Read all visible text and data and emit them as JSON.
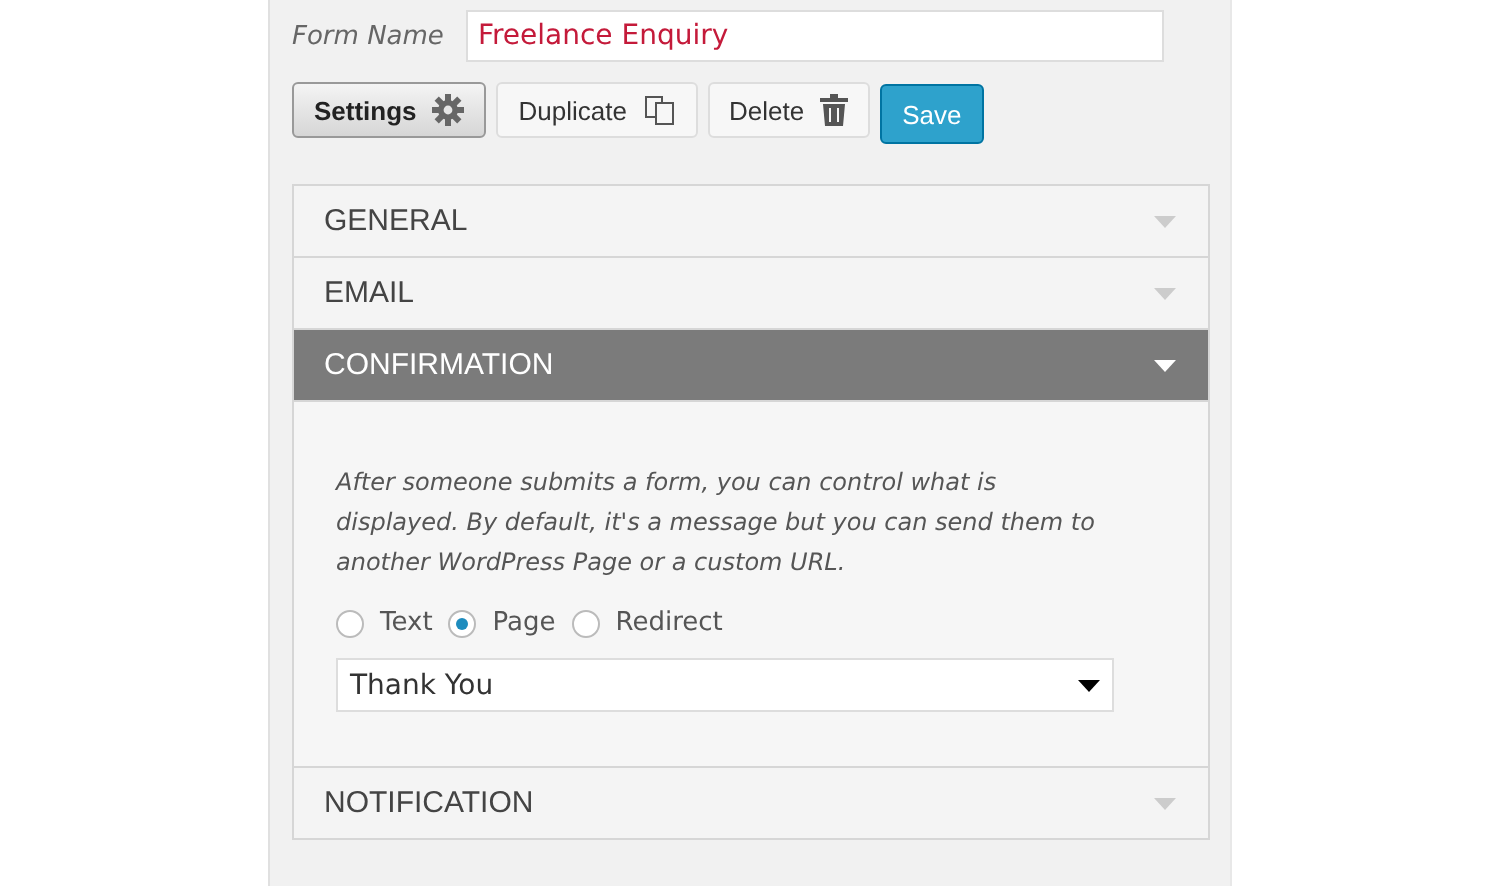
{
  "form_name": {
    "label": "Form Name",
    "value": "Freelance Enquiry"
  },
  "buttons": [
    {
      "label": "Settings",
      "kind": "settings",
      "selected": true
    },
    {
      "label": "Duplicate",
      "kind": "duplicate",
      "selected": false
    },
    {
      "label": "Delete",
      "kind": "delete",
      "selected": false
    },
    {
      "label": "Save",
      "kind": "primary",
      "selected": false
    }
  ],
  "sections": [
    {
      "title": "GENERAL",
      "expanded": false
    },
    {
      "title": "EMAIL",
      "expanded": false
    },
    {
      "title": "CONFIRMATION",
      "expanded": true,
      "description": "After someone submits a form, you can control what is displayed. By default, it's a message but you can send them to another WordPress Page or a custom URL.",
      "options": [
        {
          "label": "Text",
          "selected": false
        },
        {
          "label": "Page",
          "selected": true
        },
        {
          "label": "Redirect",
          "selected": false
        }
      ],
      "select": {
        "value": "Thank You"
      }
    },
    {
      "title": "NOTIFICATION",
      "expanded": false
    }
  ]
}
